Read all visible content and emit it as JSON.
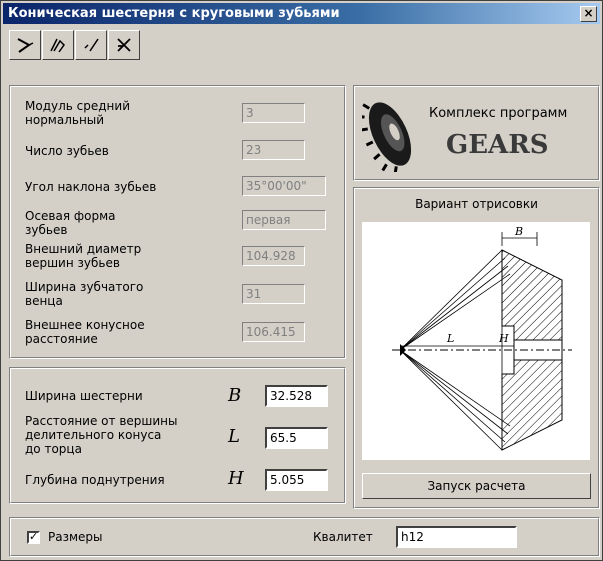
{
  "window": {
    "title": "Коническая шестерня с круговыми зубьями",
    "close_glyph": "×"
  },
  "toolbar": {
    "buttons": [
      "pen-icon",
      "edit-icon",
      "check-icon",
      "cross-icon"
    ]
  },
  "params": [
    {
      "label": "Модуль средний\nнормальный",
      "value": "3"
    },
    {
      "label": "Число зубьев",
      "value": "23"
    },
    {
      "label": "Угол наклона зубьев",
      "value": "35°00'00\""
    },
    {
      "label": "Осевая форма\nзубьев",
      "value": "первая"
    },
    {
      "label": "Внешний диаметр\nвершин зубьев",
      "value": "104.928"
    },
    {
      "label": "Ширина зубчатого\nвенца",
      "value": "31"
    },
    {
      "label": "Внешнее конусное\nрасстояние",
      "value": "106.415"
    }
  ],
  "inputs": [
    {
      "label": "Ширина шестерни",
      "symbol": "B",
      "value": "32.528"
    },
    {
      "label": "Расстояние от вершины\nделительного конуса\nдо торца",
      "symbol": "L",
      "value": "65.5"
    },
    {
      "label": "Глубина поднутрения",
      "symbol": "H",
      "value": "5.055"
    }
  ],
  "logo": {
    "line1": "Комплекс программ",
    "line2": "GEARS"
  },
  "drawing": {
    "title": "Вариант отрисовки",
    "dim_b": "B",
    "dim_l": "L",
    "dim_h": "H"
  },
  "run_button": "Запуск расчета",
  "footer": {
    "sizes_label": "Размеры",
    "sizes_checked": true,
    "check_glyph": "✓",
    "quality_label": "Квалитет",
    "quality_value": "h12"
  }
}
